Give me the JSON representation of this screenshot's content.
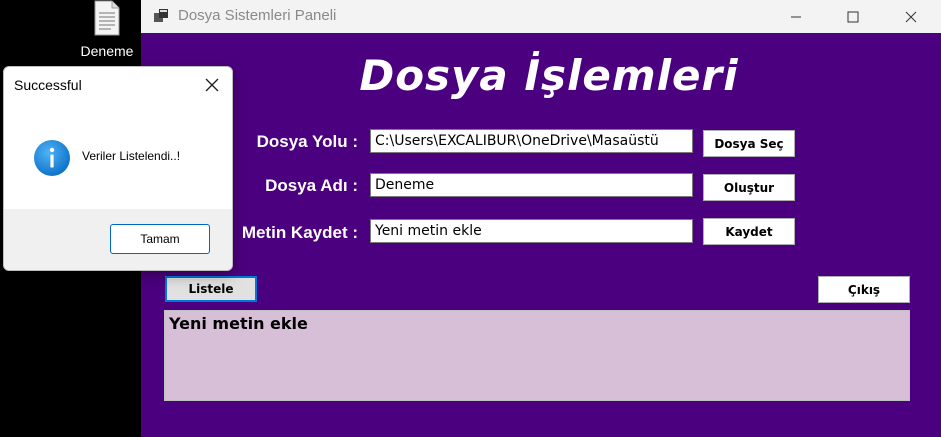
{
  "desktop": {
    "icon_label": "Deneme"
  },
  "window": {
    "title": "Dosya Sistemleri Paneli",
    "heading": "Dosya İşlemleri",
    "fields": {
      "path_label": "Dosya Yolu :",
      "path_value": "C:\\Users\\EXCALIBUR\\OneDrive\\Masaüstü",
      "name_label": "Dosya Adı :",
      "name_value": "Deneme",
      "text_label": "Metin Kaydet :",
      "text_value": "Yeni metin ekle"
    },
    "buttons": {
      "select_file": "Dosya Seç",
      "create": "Oluştur",
      "save": "Kaydet",
      "list": "Listele",
      "exit": "Çıkış"
    },
    "output_text": "Yeni metin ekle",
    "colors": {
      "client_bg": "#4b007f",
      "output_bg": "#d8bfd8",
      "accent": "#0078d7"
    }
  },
  "dialog": {
    "title": "Successful",
    "message": "Veriler Listelendi..!",
    "ok_label": "Tamam",
    "icon": "info-icon"
  }
}
